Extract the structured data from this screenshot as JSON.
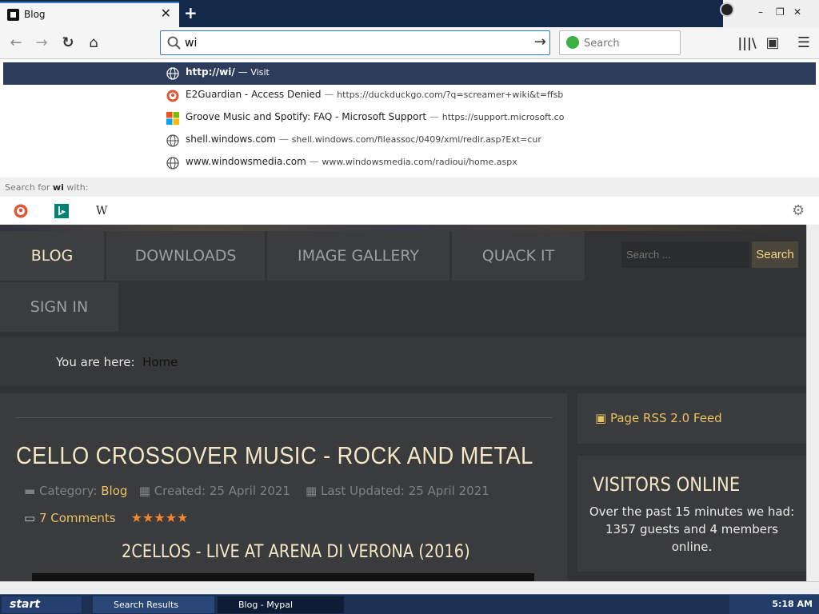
{
  "browser": {
    "tab_title": "Blog",
    "url_text": "wi",
    "search_placeholder": "Search"
  },
  "autocomplete": {
    "rows": [
      {
        "title": "http://wi/",
        "sep": "—",
        "url": "Visit",
        "icon": "globe-icon"
      },
      {
        "title": "E2Guardian - Access Denied",
        "sep": "—",
        "url": "https://duckduckgo.com/?q=screamer+wiki&t=ffsb",
        "icon": "duckduckgo-icon"
      },
      {
        "title": "Groove Music and Spotify: FAQ - Microsoft Support",
        "sep": "—",
        "url": "https://support.microsoft.co",
        "icon": "microsoft-icon"
      },
      {
        "title": "shell.windows.com",
        "sep": "—",
        "url": "shell.windows.com/fileassoc/0409/xml/redir.asp?Ext=cur",
        "icon": "globe-icon"
      },
      {
        "title": "www.windowsmedia.com",
        "sep": "—",
        "url": "www.windowsmedia.com/radioui/home.aspx",
        "icon": "globe-icon"
      }
    ],
    "search_for_prefix": "Search for ",
    "search_for_term": "wi",
    "search_for_suffix": " with:",
    "wiki_letter": "W"
  },
  "site": {
    "nav": [
      "BLOG",
      "DOWNLOADS",
      "IMAGE GALLERY",
      "QUACK IT",
      "SIGN IN"
    ],
    "search_placeholder": "Search ...",
    "search_button": "Search",
    "breadcrumb_prefix": "You are here:",
    "breadcrumb_current": "Home",
    "article": {
      "title": "CELLO CROSSOVER MUSIC - ROCK AND METAL",
      "category_label": "Category:",
      "category": "Blog",
      "created": "Created: 25 April 2021",
      "updated": "Last Updated: 25 April 2021",
      "comments": "7 Comments",
      "rating": 5,
      "subtitle": "2CELLOS - LIVE AT ARENA DI VERONA (2016)"
    },
    "rss": "Page RSS 2.0 Feed",
    "visitors": {
      "title": "VISITORS ONLINE",
      "text": "Over the past 15 minutes we had: 1357 guests and 4 members online."
    }
  },
  "taskbar": {
    "start": "start",
    "tasks": [
      "Search Results",
      "Blog - Mypal"
    ],
    "clock": "5:18 AM"
  },
  "colors": {
    "accent": "#e9c264",
    "selected_row": "#2c3c5a",
    "taskbar": "#1b2f52"
  }
}
